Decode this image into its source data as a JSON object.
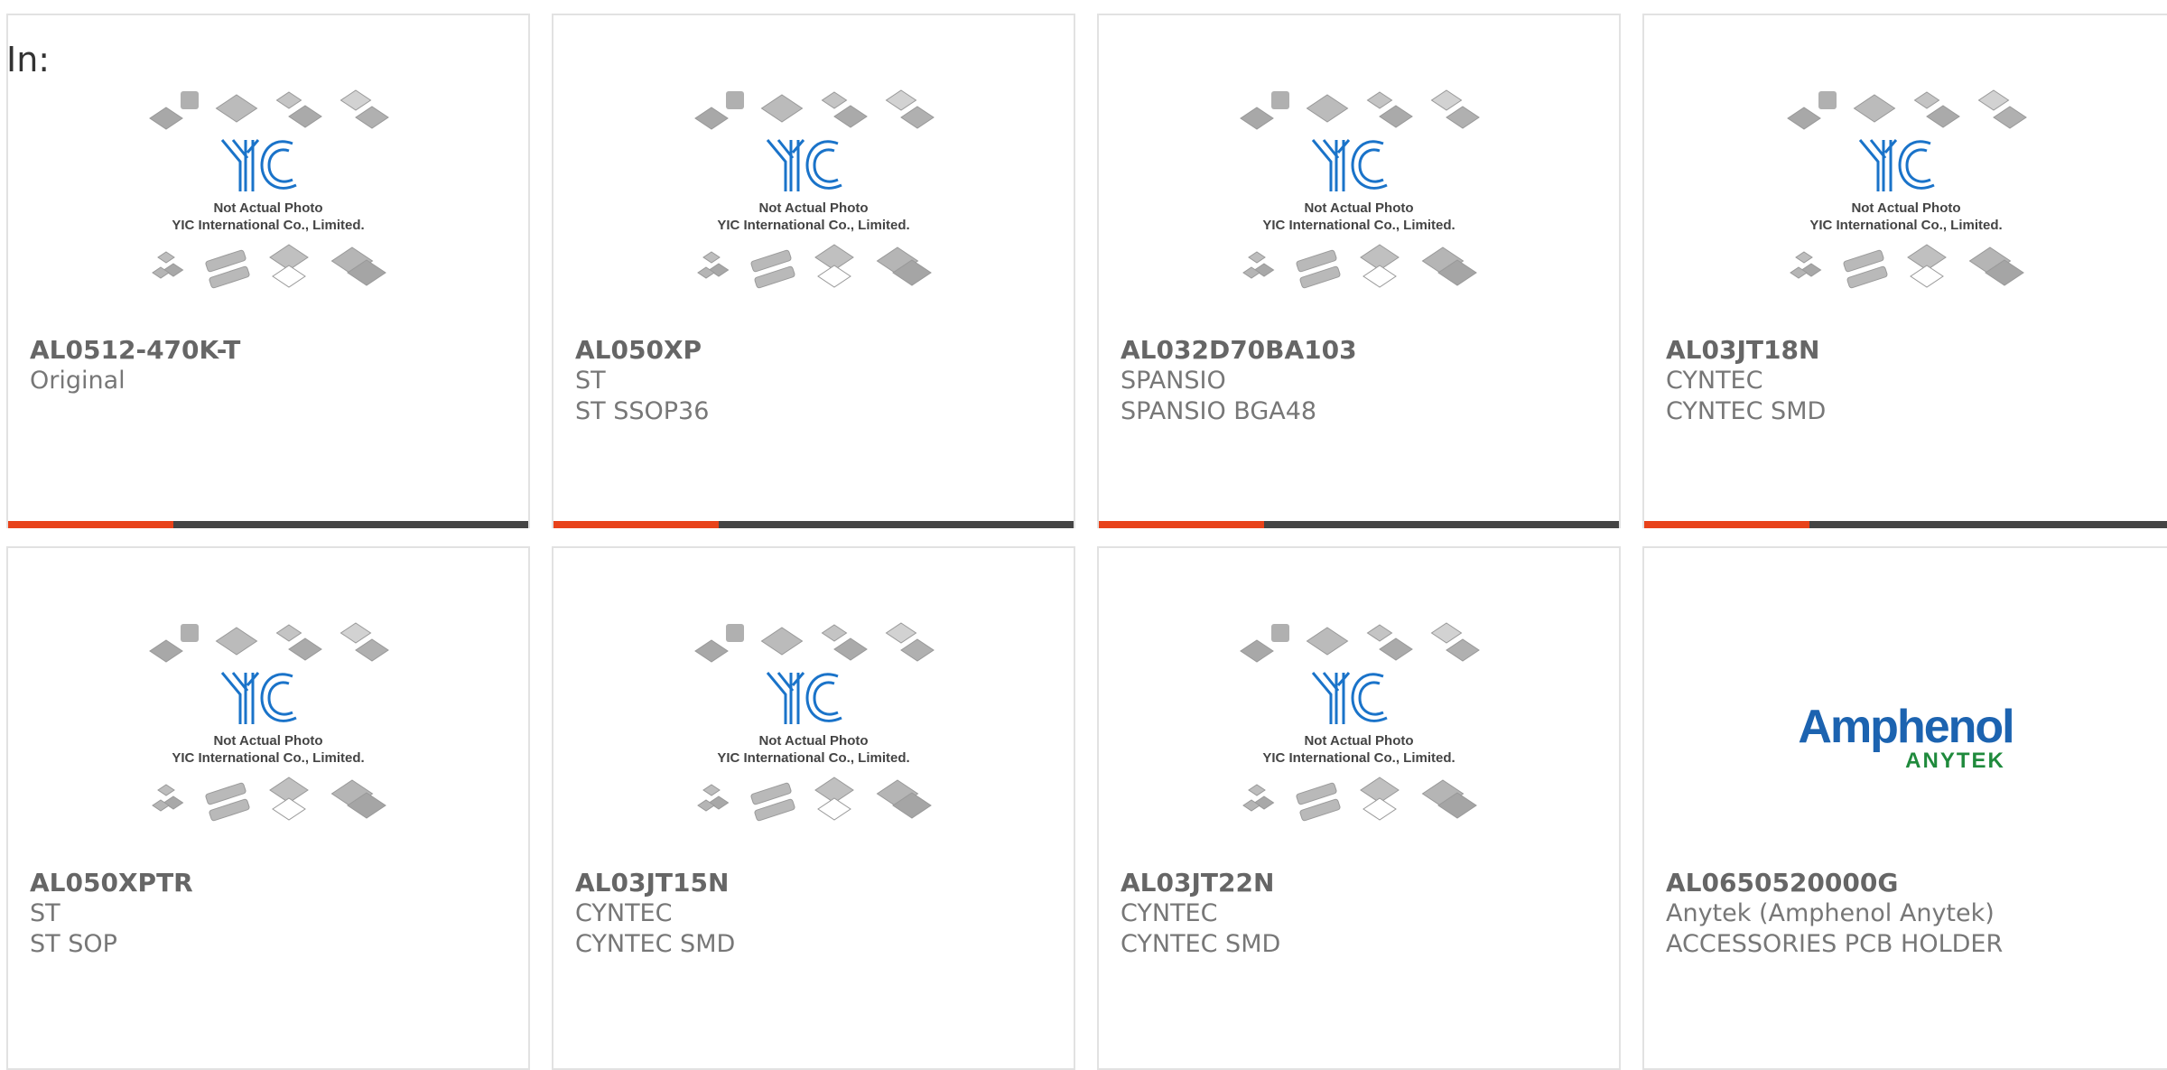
{
  "header": {
    "in_label": "In:"
  },
  "placeholder_image": {
    "caption_line1": "Not Actual Photo",
    "caption_line2": "YIC International Co., Limited.",
    "logo_text": "YIC"
  },
  "products": [
    {
      "part_number": "AL0512-470K-T",
      "line1": "Original",
      "line2": "",
      "image": "yic-placeholder",
      "accent_bar": true
    },
    {
      "part_number": "AL050XP",
      "line1": "ST",
      "line2": "ST SSOP36",
      "image": "yic-placeholder",
      "accent_bar": true
    },
    {
      "part_number": "AL032D70BA103",
      "line1": "SPANSIO",
      "line2": "SPANSIO BGA48",
      "image": "yic-placeholder",
      "accent_bar": true
    },
    {
      "part_number": "AL03JT18N",
      "line1": "CYNTEC",
      "line2": "CYNTEC SMD",
      "image": "yic-placeholder",
      "accent_bar": true
    },
    {
      "part_number": "AL050XPTR",
      "line1": "ST",
      "line2": "ST SOP",
      "image": "yic-placeholder",
      "accent_bar": false
    },
    {
      "part_number": "AL03JT15N",
      "line1": "CYNTEC",
      "line2": "CYNTEC SMD",
      "image": "yic-placeholder",
      "accent_bar": false
    },
    {
      "part_number": "AL03JT22N",
      "line1": "CYNTEC",
      "line2": "CYNTEC SMD",
      "image": "yic-placeholder",
      "accent_bar": false
    },
    {
      "part_number": "AL0650520000G",
      "line1": "Anytek (Amphenol Anytek)",
      "line2": "ACCESSORIES PCB HOLDER",
      "image": "amphenol-logo",
      "accent_bar": false
    }
  ],
  "amphenol_logo": {
    "brand": "Amphenol",
    "sub": "ANYTEK"
  },
  "colors": {
    "accent": "#e8421a",
    "bar_dark": "#444444",
    "border": "#e2e2e2",
    "yic_blue": "#1a73c9",
    "amphenol_blue": "#1c63b0",
    "amphenol_green": "#1f8a3c"
  }
}
